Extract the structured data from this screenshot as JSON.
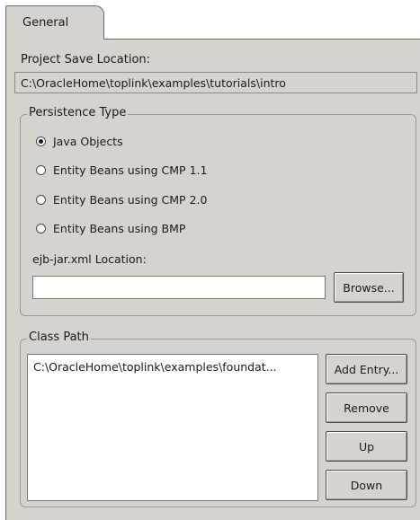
{
  "tab": {
    "label": "General"
  },
  "project_save": {
    "label": "Project Save Location:",
    "value": "C:\\OracleHome\\toplink\\examples\\tutorials\\intro"
  },
  "persistence": {
    "legend": "Persistence Type",
    "options": [
      {
        "label": "Java Objects",
        "checked": true
      },
      {
        "label": "Entity Beans using CMP 1.1",
        "checked": false
      },
      {
        "label": "Entity Beans using CMP 2.0",
        "checked": false
      },
      {
        "label": "Entity Beans using BMP",
        "checked": false
      }
    ],
    "ejb_label": "ejb-jar.xml Location:",
    "ejb_value": "",
    "browse_label": "Browse..."
  },
  "class_path": {
    "legend": "Class Path",
    "entries": [
      "C:\\OracleHome\\toplink\\examples\\foundat..."
    ],
    "buttons": {
      "add": "Add Entry...",
      "remove": "Remove",
      "up": "Up",
      "down": "Down"
    }
  }
}
